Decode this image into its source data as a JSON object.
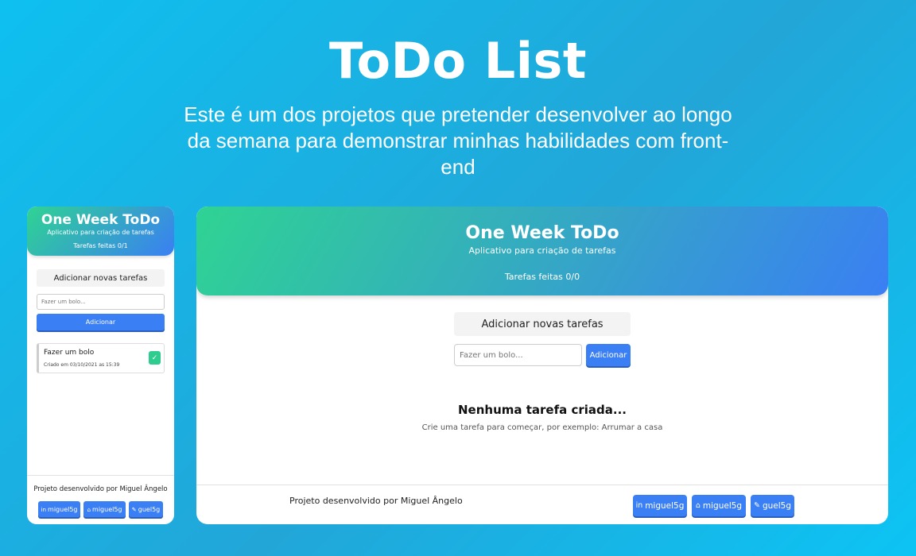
{
  "hero": {
    "title": "ToDo List",
    "subtitle": "Este é um dos projetos que pretender desenvolver ao longo da semana para demonstrar minhas habilidades com front-end"
  },
  "app": {
    "title": "One Week ToDo",
    "subtitle": "Aplicativo para criação de tarefas",
    "add_label": "Adicionar novas tarefas",
    "input_placeholder": "Fazer um bolo...",
    "add_button": "Adicionar",
    "footer_by": "Projeto desenvolvido por Miguel Ângelo",
    "social": [
      {
        "icon": "linkedin-icon",
        "label": "miguel5g"
      },
      {
        "icon": "github-icon",
        "label": "miguel5g"
      },
      {
        "icon": "twitter-icon",
        "label": "guel5g"
      }
    ]
  },
  "mobile": {
    "counter": "Tarefas feitas 0/1",
    "tasks": [
      {
        "name": "Fazer um bolo",
        "created": "Criado em 03/10/2021 as 15:39",
        "done": true
      }
    ]
  },
  "desktop": {
    "counter": "Tarefas feitas 0/0",
    "empty_title": "Nenhuma tarefa criada...",
    "empty_subtitle": "Crie uma tarefa para começar, por exemplo: Arrumar a casa"
  },
  "colors": {
    "accent": "#3a7ff3",
    "gradient_start": "#2fd393",
    "check": "#2ecc8f"
  }
}
